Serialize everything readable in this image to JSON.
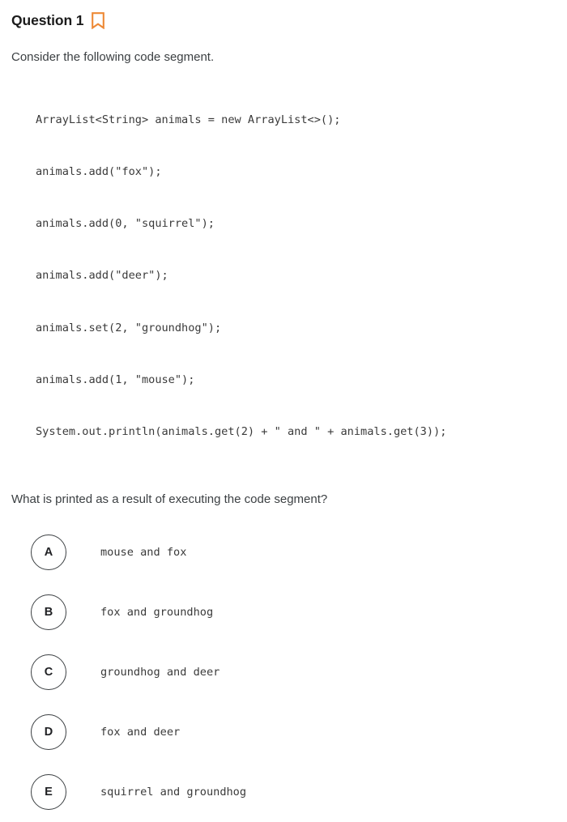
{
  "header": {
    "title": "Question 1",
    "bookmark_icon": "bookmark-icon",
    "bookmark_color": "#ED8936"
  },
  "prompt": {
    "intro": "Consider the following code segment.",
    "question": "What is printed as a result of executing the code segment?"
  },
  "code": {
    "lines": [
      "ArrayList<String> animals = new ArrayList<>();",
      "animals.add(\"fox\");",
      "animals.add(0, \"squirrel\");",
      "animals.add(\"deer\");",
      "animals.set(2, \"groundhog\");",
      "animals.add(1, \"mouse\");",
      "System.out.println(animals.get(2) + \" and \" + animals.get(3));"
    ]
  },
  "choices": [
    {
      "letter": "A",
      "text": "mouse and fox"
    },
    {
      "letter": "B",
      "text": "fox and groundhog"
    },
    {
      "letter": "C",
      "text": "groundhog and deer"
    },
    {
      "letter": "D",
      "text": "fox and deer"
    },
    {
      "letter": "E",
      "text": "squirrel and groundhog"
    }
  ]
}
